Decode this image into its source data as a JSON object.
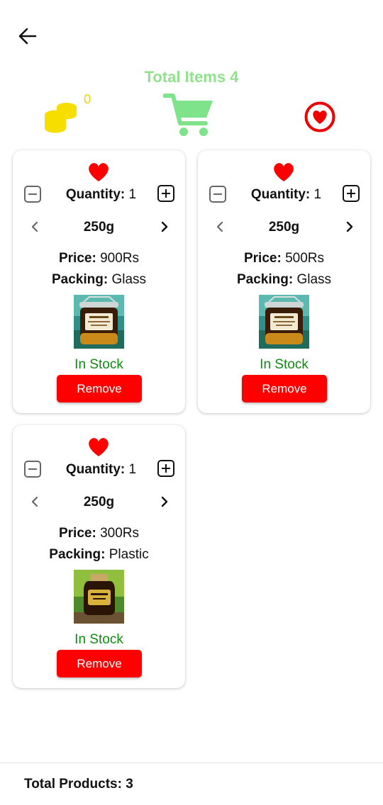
{
  "header": {
    "back_icon": "arrow-left-icon",
    "total_items_label": "Total Items 4",
    "coins_count": "0",
    "coins_icon": "coins-stack-icon",
    "cart_icon": "shopping-cart-icon",
    "favorites_icon": "heart-circle-icon"
  },
  "colors": {
    "accent_green": "#90e38c",
    "coin_yellow": "#f2d200",
    "heart_red": "#ff0000",
    "remove_red": "#ff0000",
    "stock_green": "#118a11"
  },
  "products": [
    {
      "quantity_label": "Quantity:",
      "quantity_value": " 1",
      "size": "250g",
      "price_label": "Price:",
      "price_value": " 900Rs",
      "packing_label": "Packing:",
      "packing_value": " Glass",
      "stock": "In Stock",
      "remove_label": "Remove",
      "image_type": "honey-jar-glass"
    },
    {
      "quantity_label": "Quantity:",
      "quantity_value": " 1",
      "size": "250g",
      "price_label": "Price:",
      "price_value": " 500Rs",
      "packing_label": "Packing:",
      "packing_value": " Glass",
      "stock": "In Stock",
      "remove_label": "Remove",
      "image_type": "honey-jar-glass"
    },
    {
      "quantity_label": "Quantity:",
      "quantity_value": " 1",
      "size": "250g",
      "price_label": "Price:",
      "price_value": " 300Rs",
      "packing_label": "Packing:",
      "packing_value": " Plastic",
      "stock": "In Stock",
      "remove_label": "Remove",
      "image_type": "honey-jar-plastic"
    }
  ],
  "footer": {
    "total_products_label": "Total Products: 3"
  }
}
